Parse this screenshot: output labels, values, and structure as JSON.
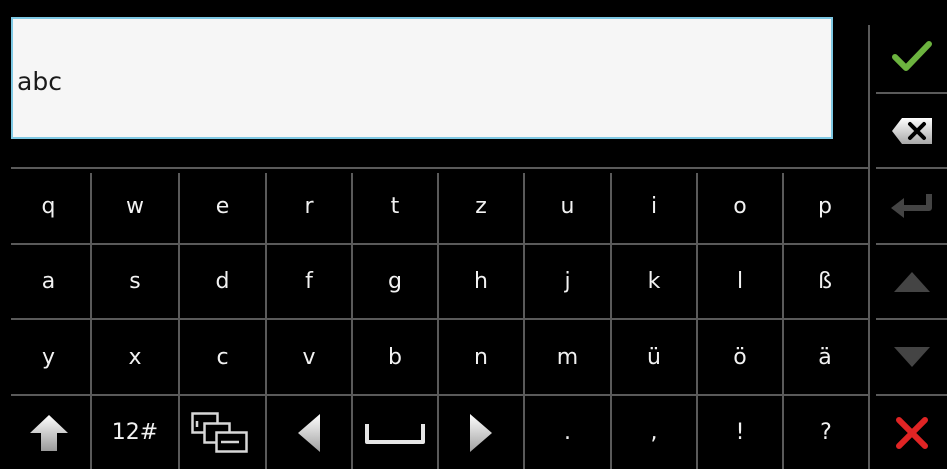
{
  "input": {
    "value": "abc"
  },
  "rows": [
    [
      "q",
      "w",
      "e",
      "r",
      "t",
      "z",
      "u",
      "i",
      "o",
      "p"
    ],
    [
      "a",
      "s",
      "d",
      "f",
      "g",
      "h",
      "j",
      "k",
      "l",
      "ß"
    ],
    [
      "y",
      "x",
      "c",
      "v",
      "b",
      "n",
      "m",
      "ü",
      "ö",
      "ä"
    ]
  ],
  "bottom_row": {
    "numeric_label": "12#",
    "dot": ".",
    "comma": ",",
    "exclaim": "!",
    "question": "?"
  },
  "colors": {
    "accent": "#7ec8e3",
    "confirm": "#6cb33f",
    "cancel": "#e02424",
    "key_text": "#f2f2f2",
    "grid": "#5a5a5a"
  },
  "icons": {
    "confirm": "checkmark-icon",
    "backspace": "backspace-icon",
    "enter": "enter-icon",
    "up": "arrow-up-icon",
    "down": "arrow-down-icon",
    "cancel": "close-icon",
    "shift": "shift-icon",
    "layout": "layout-switch-icon",
    "left": "arrow-left-icon",
    "space": "space-icon",
    "right": "arrow-right-icon"
  }
}
